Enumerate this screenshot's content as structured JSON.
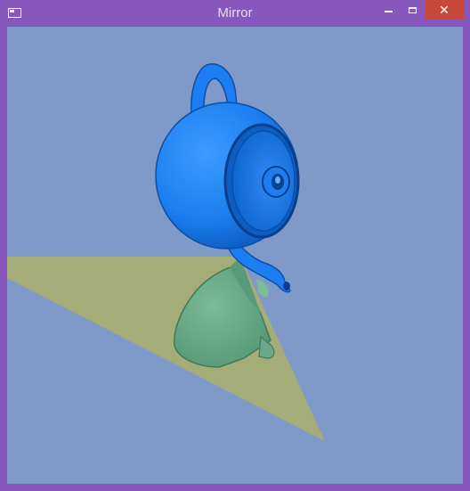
{
  "window": {
    "title": "Mirror",
    "close_glyph": "✕",
    "icons": {
      "app": "window-icon",
      "minimize": "minimize-icon",
      "maximize": "maximize-icon",
      "close": "close-icon"
    }
  },
  "colors": {
    "frame": "#8757bd",
    "background": "#7f99c8",
    "mirror": "#a6ad73",
    "teapot": "#1c7ef0",
    "reflection": "#6aa88a",
    "close_button": "#c7493a"
  }
}
